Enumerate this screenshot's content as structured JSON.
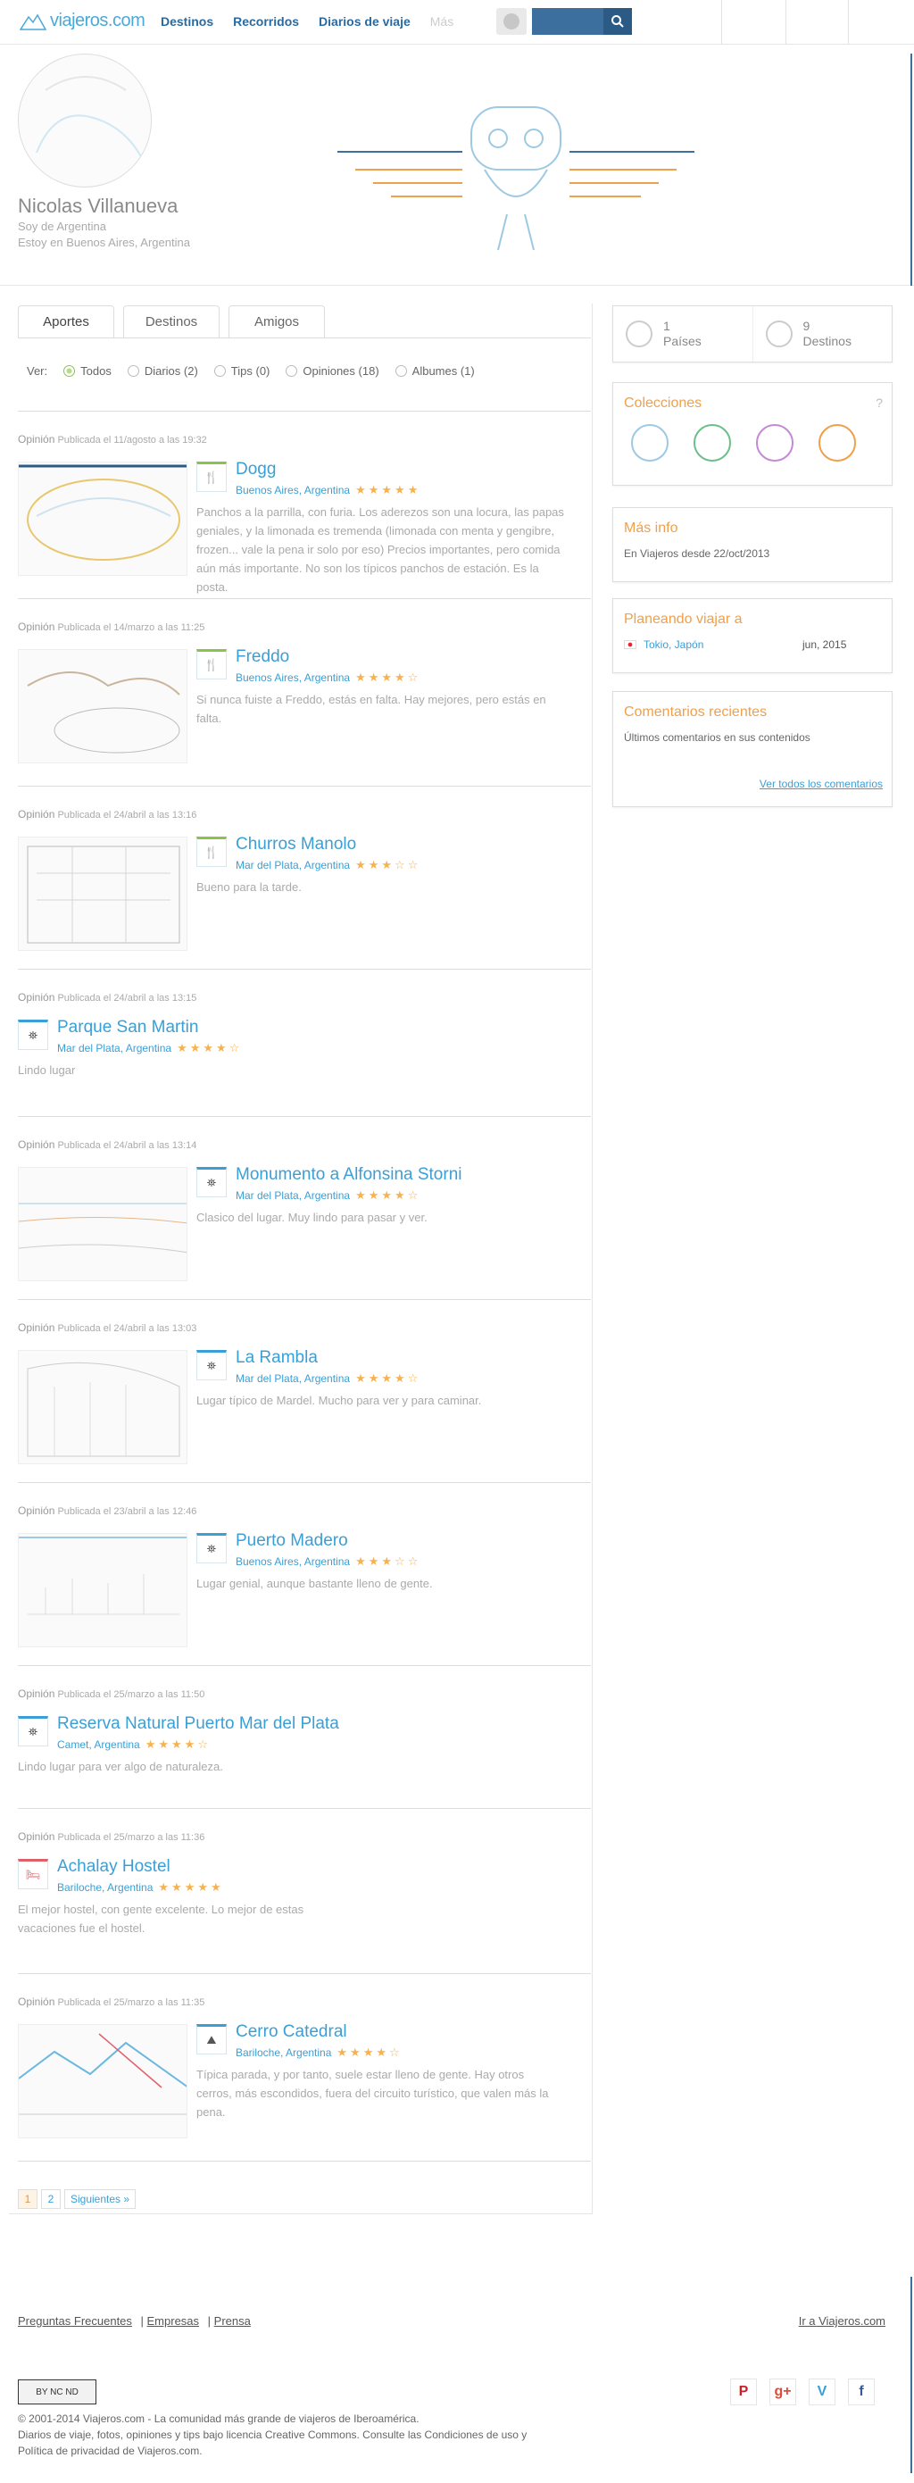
{
  "header": {
    "logo": "viajeros.com",
    "nav": [
      "Destinos",
      "Recorridos",
      "Diarios de viaje",
      "Más"
    ]
  },
  "profile": {
    "name": "Nicolas Villanueva",
    "line1": "Soy de Argentina",
    "line2": "Estoy en Buenos Aires, Argentina"
  },
  "tabs": [
    "Aportes",
    "Destinos",
    "Amigos"
  ],
  "filter": {
    "label": "Ver:",
    "options": [
      "Todos",
      "Diarios (2)",
      "Tips (0)",
      "Opiniones (18)",
      "Albumes (1)"
    ]
  },
  "entries": [
    {
      "type": "Opinión",
      "meta": "Publicada el 11/agosto a las 19:32",
      "title": "Dogg",
      "place": "Buenos Aires, Argentina",
      "stars": "★★★★★",
      "text": "Panchos a la parrilla, con furia. Los aderezos son una locura, las papas geniales, y la limonada es tremenda (limonada con menta y gengibre, frozen... vale la pena ir solo por eso) Precios importantes, pero comida aún más importante. No son los típicos panchos de estación. Es la posta."
    },
    {
      "type": "Opinión",
      "meta": "Publicada el 14/marzo a las 11:25",
      "title": "Freddo",
      "place": "Buenos Aires, Argentina",
      "stars": "★★★★☆",
      "text": "Si nunca fuiste a Freddo, estás en falta. Hay mejores, pero estás en falta."
    },
    {
      "type": "Opinión",
      "meta": "Publicada el 24/abril a las 13:16",
      "title": "Churros Manolo",
      "place": "Mar del Plata, Argentina",
      "stars": "★★★☆☆",
      "text": "Bueno para la tarde."
    },
    {
      "type": "Opinión",
      "meta": "Publicada el 24/abril a las 13:15",
      "title": "Parque San Martin",
      "place": "Mar del Plata, Argentina",
      "stars": "★★★★☆",
      "text": "Lindo lugar"
    },
    {
      "type": "Opinión",
      "meta": "Publicada el 24/abril a las 13:14",
      "title": "Monumento a Alfonsina Storni",
      "place": "Mar del Plata, Argentina",
      "stars": "★★★★☆",
      "text": "Clasico del lugar. Muy lindo para pasar y ver."
    },
    {
      "type": "Opinión",
      "meta": "Publicada el 24/abril a las 13:03",
      "title": "La Rambla",
      "place": "Mar del Plata, Argentina",
      "stars": "★★★★☆",
      "text": "Lugar típico de Mardel. Mucho para ver y para caminar."
    },
    {
      "type": "Opinión",
      "meta": "Publicada el 23/abril a las 12:46",
      "title": "Puerto Madero",
      "place": "Buenos Aires, Argentina",
      "stars": "★★★☆☆",
      "text": "Lugar genial, aunque bastante lleno de gente."
    },
    {
      "type": "Opinión",
      "meta": "Publicada el 25/marzo a las 11:50",
      "title": "Reserva Natural Puerto Mar del Plata",
      "place": "Camet, Argentina",
      "stars": "★★★★☆",
      "text": "Lindo lugar para ver algo de naturaleza."
    },
    {
      "type": "Opinión",
      "meta": "Publicada el 25/marzo a las 11:36",
      "title": "Achalay Hostel",
      "place": "Bariloche, Argentina",
      "stars": "★★★★★",
      "text": "El mejor hostel, con gente excelente. Lo mejor de estas vacaciones fue el hostel."
    },
    {
      "type": "Opinión",
      "meta": "Publicada el 25/marzo a las 11:35",
      "title": "Cerro Catedral",
      "place": "Bariloche, Argentina",
      "stars": "★★★★☆",
      "text": "Típica parada, y por tanto, suele estar lleno de gente. Hay otros cerros, más escondidos, fuera del circuito turístico, que valen más la pena."
    }
  ],
  "pager": {
    "page1": "1",
    "page2": "2",
    "next": "Siguientes »"
  },
  "sidebar": {
    "stat1_num": "1",
    "stat1_label": "Países",
    "stat2_num": "9",
    "stat2_label": "Destinos",
    "collections_title": "Colecciones",
    "info_title": "Más info",
    "info_text": "En Viajeros desde 22/oct/2013",
    "plan_title": "Planeando viajar a",
    "plan_place": "Tokio, Japón",
    "plan_date": "jun, 2015",
    "comments_title": "Comentarios recientes",
    "comments_text": "Últimos comentarios en sus contenidos",
    "comments_link": "Ver todos los comentarios"
  },
  "footer": {
    "link1": "Preguntas Frecuentes",
    "link2": "Empresas",
    "link3": "Prensa",
    "right_link": "Ir a Viajeros.com",
    "cc": "BY  NC  ND",
    "line1": "© 2001-2014 Viajeros.com - La comunidad más grande de viajeros de Iberoamérica.",
    "line2": "Diarios de viaje, fotos, opiniones y tips bajo licencia Creative Commons. Consulte las Condiciones de uso y",
    "line3": "Política de privacidad de Viajeros.com.",
    "social": [
      "P",
      "g+",
      "V",
      "f"
    ]
  },
  "colors": {
    "accent": "#3a9fd6",
    "orange": "#f0a04b",
    "green": "#8bc34a",
    "navy": "#3c6e9e"
  }
}
